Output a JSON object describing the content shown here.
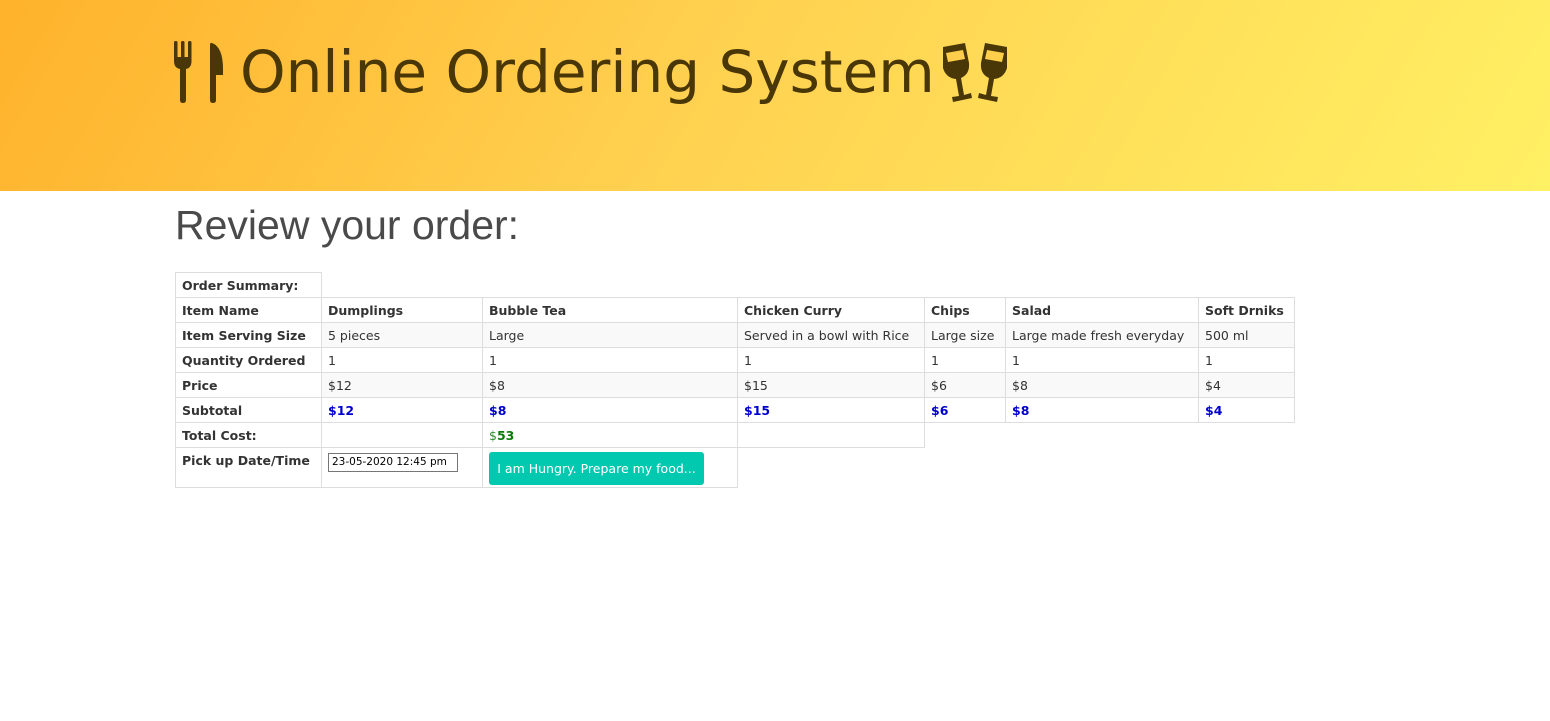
{
  "header": {
    "title": "Online Ordering System",
    "left_icon": "utensils-icon",
    "right_icon": "glass-cheers-icon"
  },
  "heading": "Review your order:",
  "summary_label": "Order Summary:",
  "rows": {
    "item_name": {
      "label": "Item Name",
      "values": [
        "Dumplings",
        "Bubble Tea",
        "Chicken Curry",
        "Chips",
        "Salad",
        "Soft Drniks"
      ]
    },
    "serving_size": {
      "label": "Item Serving Size",
      "values": [
        "5 pieces",
        "Large",
        "Served in a bowl with Rice",
        "Large size",
        "Large made fresh everyday",
        "500 ml"
      ]
    },
    "quantity": {
      "label": "Quantity Ordered",
      "values": [
        "1",
        "1",
        "1",
        "1",
        "1",
        "1"
      ]
    },
    "price": {
      "label": "Price",
      "values": [
        "$12",
        "$8",
        "$15",
        "$6",
        "$8",
        "$4"
      ]
    },
    "subtotal": {
      "label": "Subtotal",
      "values": [
        "$12",
        "$8",
        "$15",
        "$6",
        "$8",
        "$4"
      ]
    }
  },
  "total": {
    "label": "Total Cost:",
    "currency": "$",
    "value": "53"
  },
  "pickup": {
    "label": "Pick up Date/Time",
    "value": "23-05-2020 12:45 pm"
  },
  "submit_label": "I am Hungry. Prepare my food...",
  "colors": {
    "header_gradient_start": "#ffb22b",
    "header_gradient_end": "#fff064",
    "header_text": "#4a3708",
    "subtotal": "#0000cc",
    "total": "#0a7a0a",
    "button": "#00c9b0"
  }
}
